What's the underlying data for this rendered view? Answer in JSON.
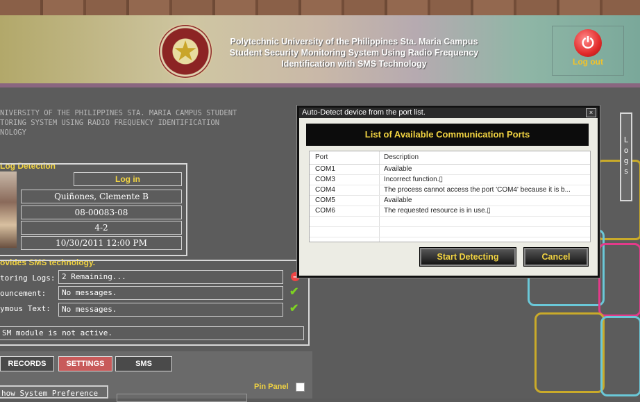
{
  "header": {
    "title_lines": [
      "Polytechnic University of the Philippines Sta. Maria Campus",
      "Student Security Monitoring System Using Radio Frequency",
      "Identification with SMS Technology"
    ],
    "logout_label": "Log out",
    "logout_icon": "power-icon"
  },
  "intro_lines": [
    "NIVERSITY OF THE PHILIPPINES STA. MARIA CAMPUS STUDENT",
    "TORING SYSTEM USING RADIO FREQUENCY IDENTIFICATION",
    "NOLOGY"
  ],
  "log_detection": {
    "section_title": "Log Detection",
    "status": "Log in",
    "name": "Quiñones, Clemente B",
    "student_id": "08-00083-08",
    "section": "4-2",
    "datetime": "10/30/2011 12:00 PM"
  },
  "sms": {
    "section_title": "ovides SMS technology.",
    "rows": [
      {
        "label": "toring Logs:",
        "value": "2 Remaining...",
        "status": "remove"
      },
      {
        "label": "ouncement:",
        "value": "No messages.",
        "status": "ok"
      },
      {
        "label": "ymous Text:",
        "value": "No messages.",
        "status": "ok"
      }
    ],
    "module_status": "SM module is not active."
  },
  "tabs": [
    {
      "label": "RECORDS",
      "active": false
    },
    {
      "label": "SETTINGS",
      "active": true
    },
    {
      "label": "SMS",
      "active": false
    }
  ],
  "system_pref": "how System Preference",
  "pin_panel": "Pin Panel",
  "logs_tab": "Logs",
  "dialog": {
    "title": "Auto-Detect device from the port list.",
    "close": "×",
    "heading": "List of Available Communication Ports",
    "columns": [
      "Port",
      "Description"
    ],
    "rows": [
      {
        "port": "COM1",
        "description": "Available"
      },
      {
        "port": "COM3",
        "description": "Incorrect function.▯"
      },
      {
        "port": "COM4",
        "description": "The process cannot access the port 'COM4' because it is b..."
      },
      {
        "port": "COM5",
        "description": "Available"
      },
      {
        "port": "COM6",
        "description": "The requested resource is in use.▯"
      }
    ],
    "start_button": "Start Detecting",
    "cancel_button": "Cancel"
  },
  "colors": {
    "accent_yellow": "#f2d442",
    "active_tab": "#c85a5a",
    "background": "#5c5c5c"
  }
}
